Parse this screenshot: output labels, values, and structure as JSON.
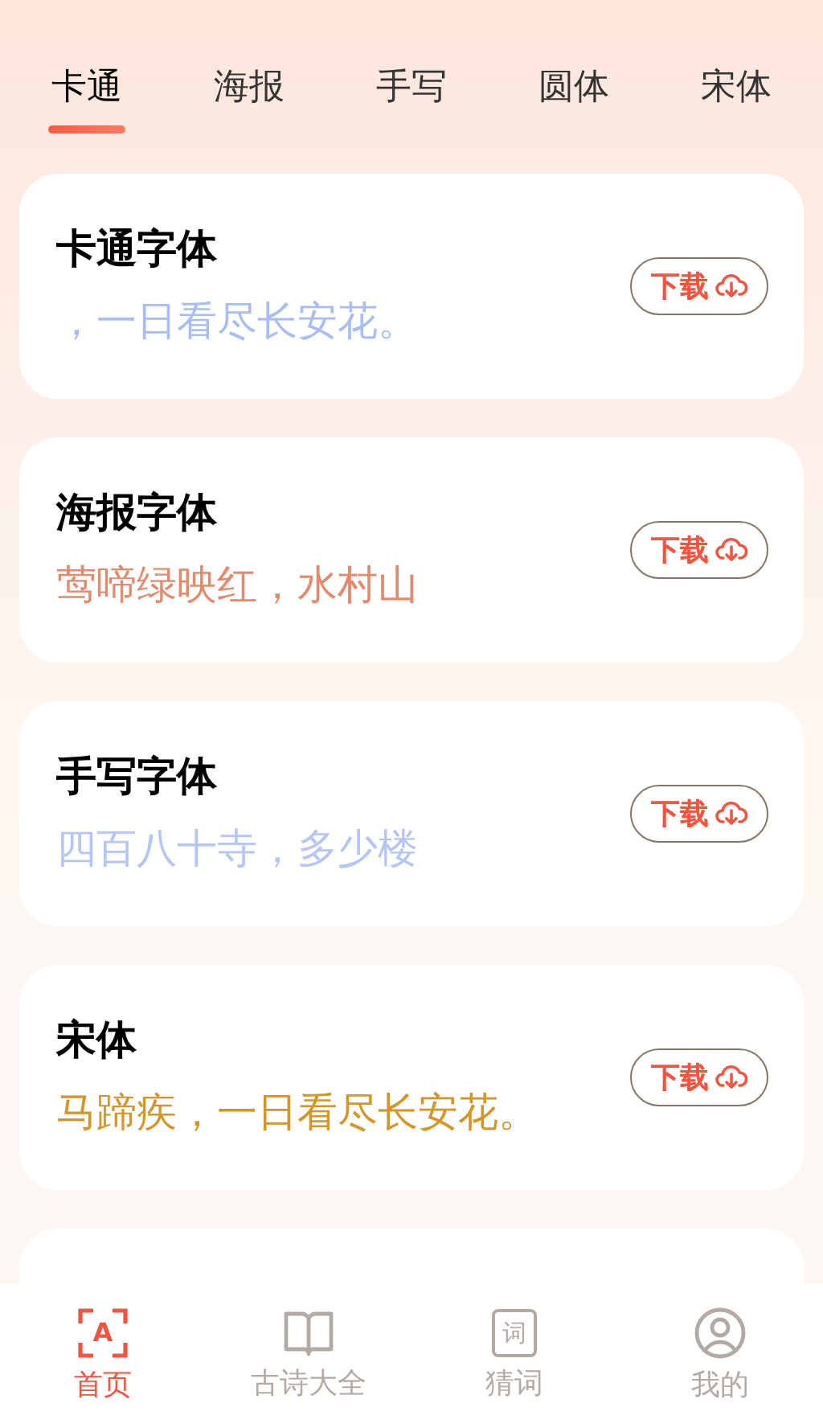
{
  "tabs": [
    {
      "label": "卡通",
      "selected": true
    },
    {
      "label": "海报",
      "selected": false
    },
    {
      "label": "手写",
      "selected": false
    },
    {
      "label": "圆体",
      "selected": false
    },
    {
      "label": "宋体",
      "selected": false
    }
  ],
  "fonts": [
    {
      "name": "卡通字体",
      "sample": "，一日看尽长安花。",
      "color": "#a9bdf5",
      "button": "下载"
    },
    {
      "name": "海报字体",
      "sample": "莺啼绿映红，水村山",
      "color": "#e38a6d",
      "button": "下载"
    },
    {
      "name": "手写字体",
      "sample": "四百八十寺，多少楼",
      "color": "#b4c5f7",
      "button": "下载"
    },
    {
      "name": "宋体",
      "sample": "马蹄疾，一日看尽长安花。",
      "color": "#d4952a",
      "button": "下载"
    }
  ],
  "nav": [
    {
      "label": "首页",
      "kind": "font",
      "glyph": "A",
      "selected": true
    },
    {
      "label": "古诗大全",
      "kind": "book",
      "selected": false
    },
    {
      "label": "猜词",
      "kind": "word",
      "glyph": "词",
      "selected": false
    },
    {
      "label": "我的",
      "kind": "user",
      "selected": false
    }
  ]
}
